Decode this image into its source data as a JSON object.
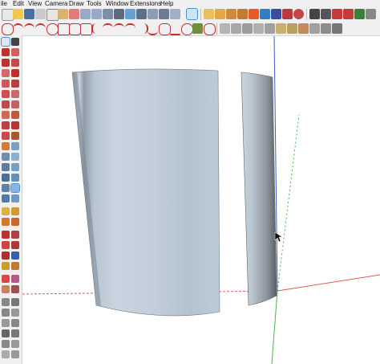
{
  "menu": [
    "ile",
    "Edit",
    "View",
    "Camera",
    "Draw",
    "Tools",
    "Window",
    "Extensions",
    "Help"
  ],
  "toolbar_top": {
    "buttons": [
      "new-icon",
      "open-icon",
      "save-icon",
      "cut-icon",
      "copy-icon",
      "paste-icon",
      "erase-icon",
      "undo-icon",
      "redo-icon",
      "print-icon",
      "home-icon",
      "zoom-extents-icon",
      "camera-icon",
      "camera-settings-icon",
      "select-icon",
      "components-icon",
      "paint-icon",
      "sandbox-icon",
      "warehouse-icon",
      "extension-warehouse-icon",
      "layout-icon",
      "styles-icon",
      "pen-icon",
      "axes-icon",
      "dimension-icon",
      "text-icon",
      "section-icon",
      "show-section-icon",
      "xray-icon",
      "model-info-icon"
    ],
    "active": "select-icon"
  },
  "toolbar_second": {
    "buttons": [
      "freehand-icon",
      "arc-icon",
      "two-point-arc-icon",
      "three-point-arc-icon",
      "pie-icon",
      "rectangle-icon",
      "rotated-rectangle-icon",
      "circle-icon",
      "polygon-icon",
      "line-icon",
      "bezier-icon",
      "curve-icon",
      "spline-icon",
      "wave-icon",
      "offset-icon",
      "push-pull-icon",
      "follow-me-icon",
      "intersect-icon",
      "outer-shell-icon",
      "union-icon",
      "subtract-icon",
      "trim-icon",
      "split-icon",
      "layers-icon",
      "scenes-icon",
      "shadows-icon",
      "fog-icon",
      "match-photo-icon",
      "solid-tools-icon"
    ]
  },
  "tool_palette": {
    "active": "orbit-icon"
  },
  "model": {
    "axis_red": "#e05a5a",
    "axis_green": "#49b349",
    "axis_blue": "#3b5cc6",
    "surface_color": "#bccbd6",
    "cursor": "pointer"
  }
}
